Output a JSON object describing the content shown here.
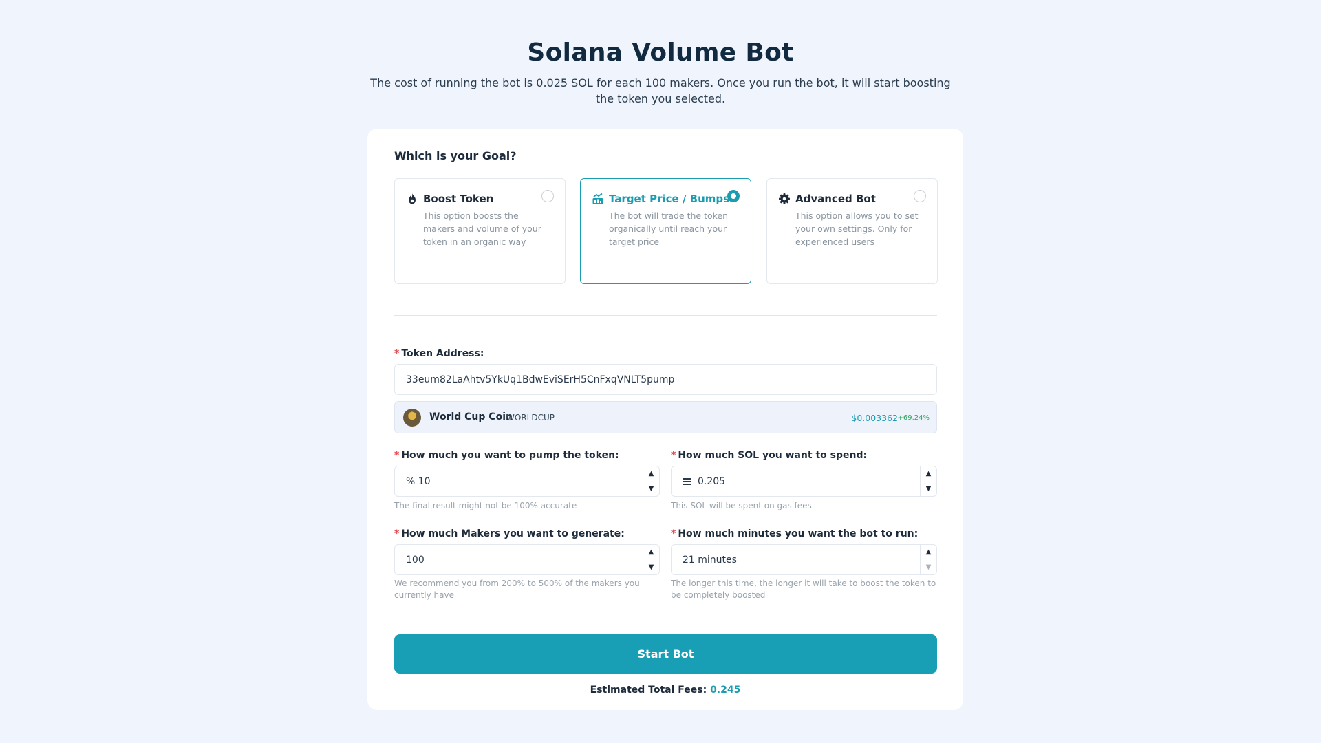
{
  "header": {
    "title": "Solana Volume Bot",
    "subtitle": "The cost of running the bot is 0.025 SOL for each 100 makers. Once you run the bot, it will start boosting the token you selected."
  },
  "goal": {
    "label": "Which is your Goal?",
    "options": [
      {
        "title": "Boost Token",
        "description": "This option boosts the makers and volume of your token in an organic way",
        "icon": "fire-icon",
        "selected": false
      },
      {
        "title": "Target Price / Bumps",
        "description": "The bot will trade the token organically until reach your target price",
        "icon": "chart-icon",
        "selected": true
      },
      {
        "title": "Advanced Bot",
        "description": "This option allows you to set your own settings. Only for experienced users",
        "icon": "gear-icon",
        "selected": false
      }
    ]
  },
  "token": {
    "label": "Token Address:",
    "address": "33eum82LaAhtv5YkUq1BdwEviSErH5CnFxqVNLT5pump",
    "name": "World Cup Coin",
    "symbol": "WORLDCUP",
    "price": "$0.003362",
    "change": "+69.24%"
  },
  "fields": {
    "pump": {
      "label": "How much you want to pump the token:",
      "value": "% 10",
      "hint": "The final result might not be 100% accurate"
    },
    "sol": {
      "label": "How much SOL you want to spend:",
      "value": "0.205",
      "hint": "This SOL will be spent on gas fees"
    },
    "makers": {
      "label": "How much Makers you want to generate:",
      "value": "100",
      "hint": "We recommend you from 200% to 500% of the makers you currently have"
    },
    "minutes": {
      "label": "How much minutes you want the bot to run:",
      "value": "21 minutes",
      "hint": "The longer this time, the longer it will take to boost the token to be completely boosted"
    }
  },
  "required_mark": "*",
  "start_button": "Start Bot",
  "fees": {
    "label": "Estimated Total Fees:",
    "value": "0.245"
  },
  "colors": {
    "accent": "#199fb5",
    "background": "#eff4fd",
    "required": "#e5484d",
    "positive": "#2fa562"
  }
}
